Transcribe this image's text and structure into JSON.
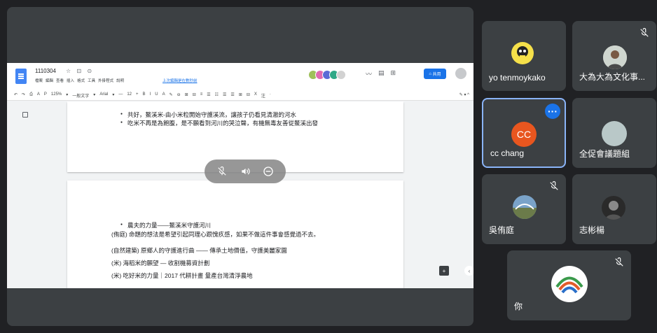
{
  "doc": {
    "title": "1110304",
    "title_icons": "☆ ⊡ ⊙",
    "menus": [
      "檔案",
      "編輯",
      "查看",
      "插入",
      "格式",
      "工具",
      "外掛程式",
      "說明"
    ],
    "last_edit": "上次編輯是在數秒前",
    "share_label": "共用",
    "toolbar": [
      "↶",
      "↷",
      "⎙",
      "A",
      "P",
      "125%",
      "▾",
      "一般文字",
      "▾",
      "Arial",
      "▾",
      "—",
      "12",
      "+",
      "B",
      "I",
      "U",
      "A",
      "✎",
      "⊖",
      "⊞",
      "⊟",
      "≡",
      "☰",
      "☷",
      "☰",
      "☰",
      "⊞",
      "⊟",
      "X",
      "注",
      "·"
    ],
    "ruler": [
      "2",
      "1",
      "1",
      "2",
      "3",
      "4",
      "5",
      "6",
      "7",
      "8",
      "9",
      "10",
      "11",
      "12",
      "13",
      "14",
      "15",
      "16",
      "17",
      "18"
    ],
    "page1_lines": [
      "共好，鰲溪米-由小米粒開始守護溪流，讓孩子仍看見清澈的河水",
      "吃米不再是為飽腹，是不願看到河川的哭泣聲，有機無毒友善從鰲溪出發"
    ],
    "page2_bullet": "農夫的力量——鰲溪米守護河川",
    "page2_lines": [
      "(侑庭) 命題的想法是希望引起同理心跟愧疚感，如果不做這件事會感覺過不去。",
      "(自然建築) 原鄉人的守護進行曲 —— 傳承土地價值，守護美麗家園",
      "(米) 海稻米的願望 — 收割機募資計劃",
      "(米) 吃好米的力量｜2017 代耕計畫 量產台灣清淨農地"
    ]
  },
  "participants": [
    {
      "name": "yo tenmoykako",
      "muted": false
    },
    {
      "name": "大為大為文化事...",
      "muted": true
    },
    {
      "name": "cc chang",
      "initials": "CC",
      "muted": false,
      "active": true
    },
    {
      "name": "全促會議題組",
      "muted": false
    },
    {
      "name": "吳侑庭",
      "muted": true
    },
    {
      "name": "志彬楊",
      "muted": false
    },
    {
      "name": "你",
      "muted": true
    }
  ],
  "colors": {
    "background": "#202124",
    "tile": "#3c4043",
    "accent": "#1a73e8",
    "active_border": "#8ab4f8",
    "cc_avatar": "#e8561f",
    "gray_avatar": "#b9c8c8"
  },
  "icons": {
    "overlay": [
      "mic-off-icon",
      "volume-icon",
      "remove-icon"
    ],
    "more": "more-options-icon"
  }
}
